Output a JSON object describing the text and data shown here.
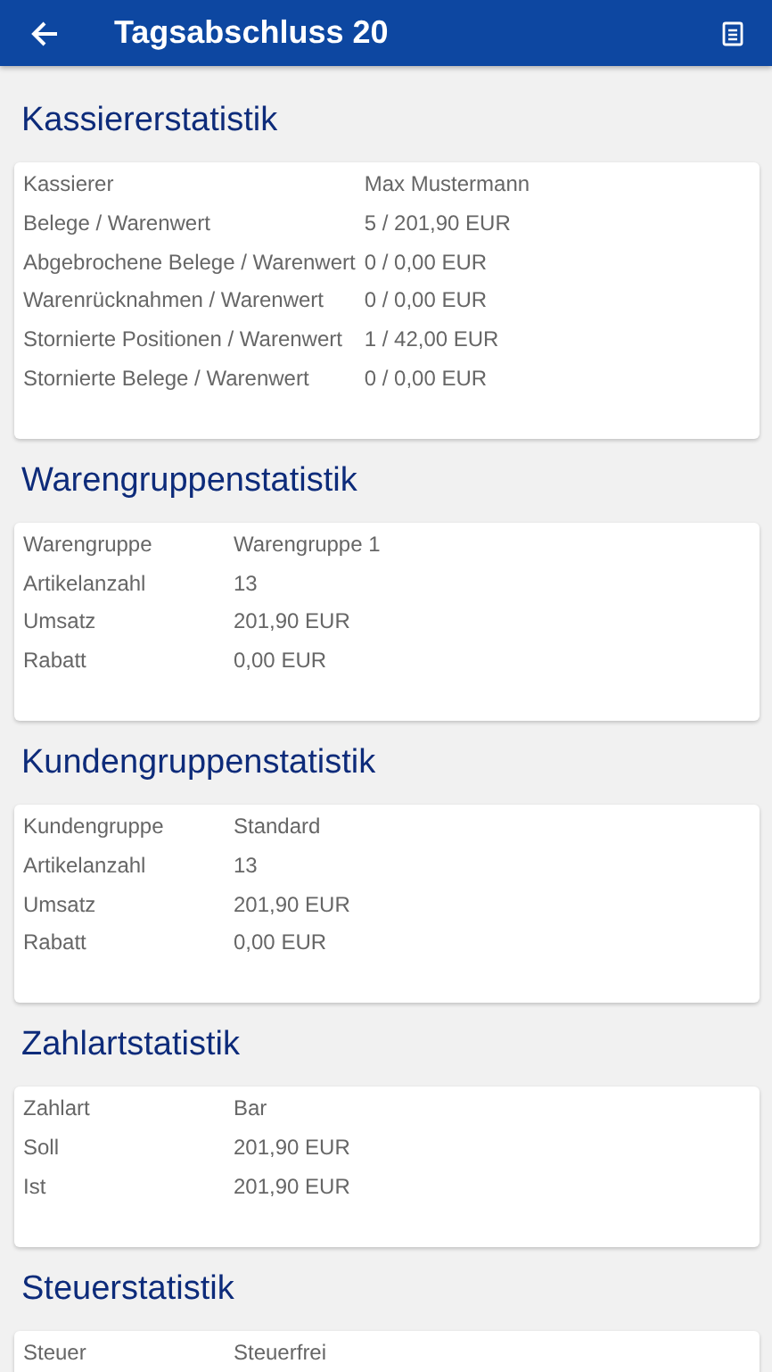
{
  "app_bar": {
    "title": "Tagsabschluss 20"
  },
  "sections": [
    {
      "heading": "Kassiererstatistik",
      "rows": [
        {
          "label": "Kassierer",
          "value": "Max Mustermann"
        },
        {
          "label": "Belege / Warenwert",
          "value": "5 / 201,90 EUR"
        },
        {
          "label": "Abgebrochene Belege / Warenwert",
          "value": "0 / 0,00 EUR"
        },
        {
          "label": "Warenrücknahmen / Warenwert",
          "value": "0 / 0,00 EUR"
        },
        {
          "label": "Stornierte Positionen / Warenwert",
          "value": "1 / 42,00 EUR"
        },
        {
          "label": "Stornierte Belege / Warenwert",
          "value": "0 / 0,00 EUR"
        }
      ]
    },
    {
      "heading": "Warengruppenstatistik",
      "rows": [
        {
          "label": "Warengruppe",
          "value": "Warengruppe 1"
        },
        {
          "label": "Artikelanzahl",
          "value": "13"
        },
        {
          "label": "Umsatz",
          "value": "201,90 EUR"
        },
        {
          "label": "Rabatt",
          "value": "0,00 EUR"
        }
      ]
    },
    {
      "heading": "Kundengruppenstatistik",
      "rows": [
        {
          "label": "Kundengruppe",
          "value": "Standard"
        },
        {
          "label": "Artikelanzahl",
          "value": "13"
        },
        {
          "label": "Umsatz",
          "value": "201,90 EUR"
        },
        {
          "label": "Rabatt",
          "value": "0,00 EUR"
        }
      ]
    },
    {
      "heading": "Zahlartstatistik",
      "rows": [
        {
          "label": "Zahlart",
          "value": "Bar"
        },
        {
          "label": "Soll",
          "value": "201,90 EUR"
        },
        {
          "label": "Ist",
          "value": "201,90 EUR"
        }
      ]
    },
    {
      "heading": "Steuerstatistik",
      "rows": [
        {
          "label": "Steuer",
          "value": "Steuerfrei"
        }
      ]
    }
  ]
}
